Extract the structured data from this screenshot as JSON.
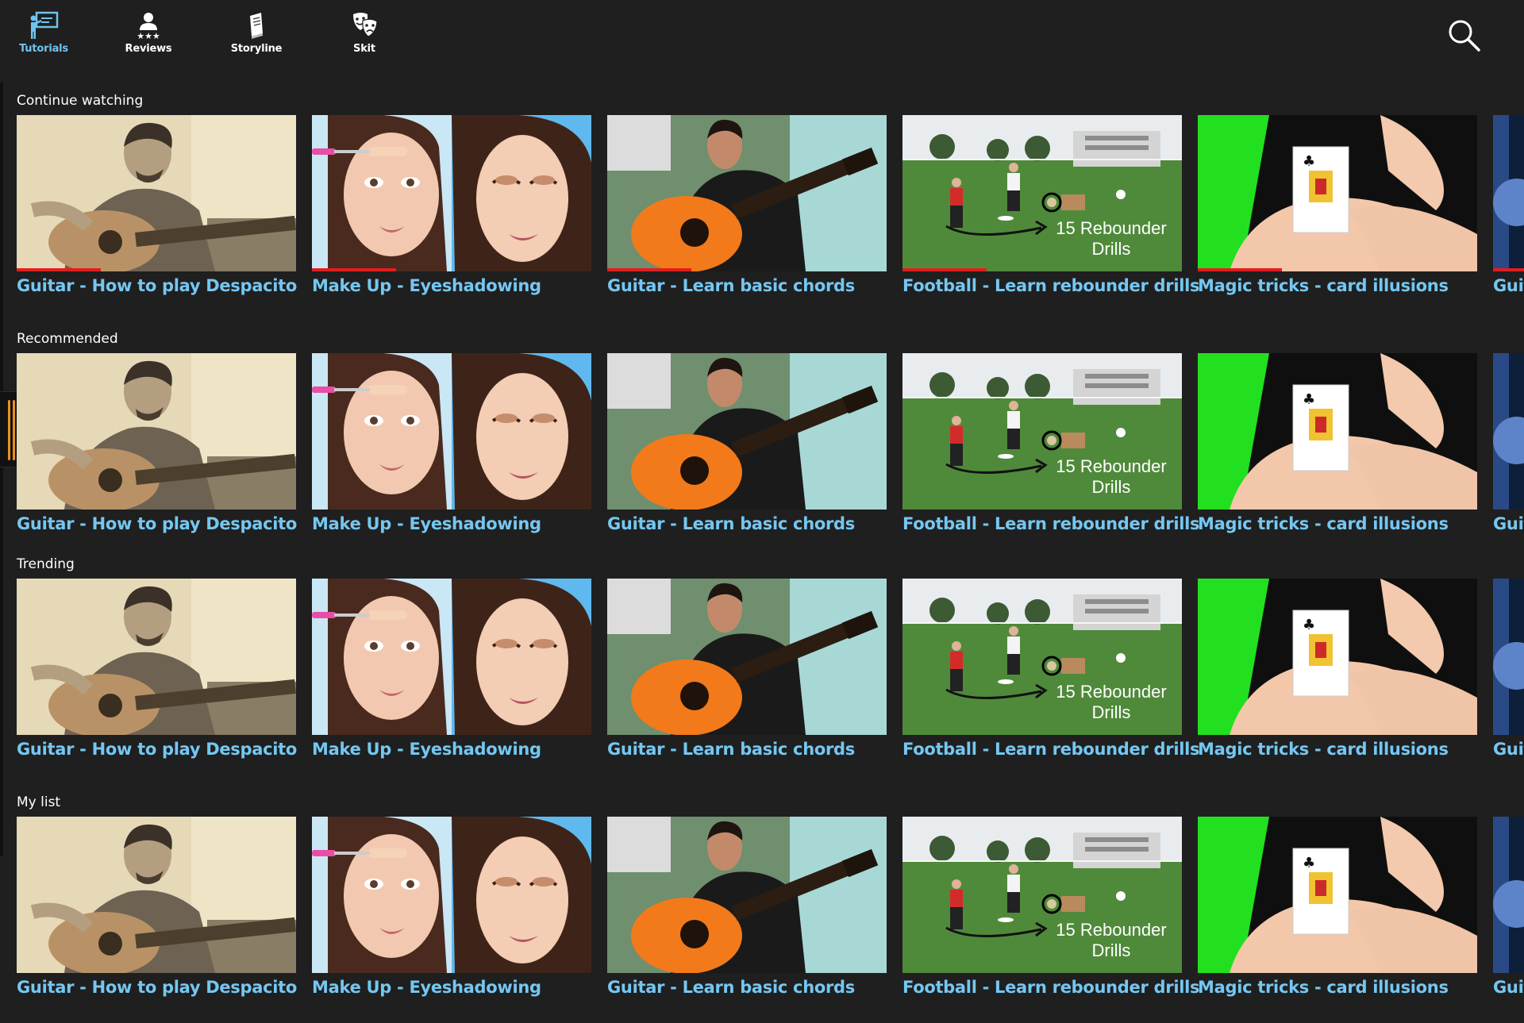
{
  "nav": {
    "items": [
      {
        "label": "Tutorials",
        "icon": "tutorial-presenter-icon",
        "active": true
      },
      {
        "label": "Reviews",
        "icon": "user-stars-icon",
        "active": false
      },
      {
        "label": "Storyline",
        "icon": "book-icon",
        "active": false
      },
      {
        "label": "Skit",
        "icon": "theater-masks-icon",
        "active": false
      }
    ],
    "search_icon": "search-icon"
  },
  "colors": {
    "background": "#1f1f1f",
    "active_nav": "#6fc3f0",
    "card_title": "#74c7f2",
    "progress": "#e31d1d",
    "scroll_handle": "#e8921e"
  },
  "sections": [
    {
      "title": "Continue watching",
      "cards": [
        {
          "title": "Guitar - How to play Despacito",
          "thumb": "guitar-sepia",
          "progress": 0.3
        },
        {
          "title": "Make Up - Eyeshadowing",
          "thumb": "makeup",
          "progress": 0.3
        },
        {
          "title": "Guitar - Learn basic chords",
          "thumb": "guitar-orange",
          "progress": 0.3
        },
        {
          "title": "Football - Learn rebounder drills",
          "thumb": "football",
          "progress": 0.3
        },
        {
          "title": "Magic tricks - card illusions",
          "thumb": "magic",
          "progress": 0.3
        },
        {
          "title": "Guit",
          "thumb": "partial",
          "progress": 0.3
        }
      ]
    },
    {
      "title": "Recommended",
      "cards": [
        {
          "title": "Guitar - How to play Despacito",
          "thumb": "guitar-sepia"
        },
        {
          "title": "Make Up - Eyeshadowing",
          "thumb": "makeup"
        },
        {
          "title": "Guitar - Learn basic chords",
          "thumb": "guitar-orange"
        },
        {
          "title": "Football - Learn rebounder drills",
          "thumb": "football"
        },
        {
          "title": "Magic tricks - card illusions",
          "thumb": "magic"
        },
        {
          "title": "Guit",
          "thumb": "partial"
        }
      ]
    },
    {
      "title": "Trending",
      "cards": [
        {
          "title": "Guitar - How to play Despacito",
          "thumb": "guitar-sepia"
        },
        {
          "title": "Make Up - Eyeshadowing",
          "thumb": "makeup"
        },
        {
          "title": "Guitar - Learn basic chords",
          "thumb": "guitar-orange"
        },
        {
          "title": "Football - Learn rebounder drills",
          "thumb": "football"
        },
        {
          "title": "Magic tricks - card illusions",
          "thumb": "magic"
        },
        {
          "title": "Guit",
          "thumb": "partial"
        }
      ]
    },
    {
      "title": "My list",
      "cards": [
        {
          "title": "Guitar - How to play Despacito",
          "thumb": "guitar-sepia"
        },
        {
          "title": "Make Up - Eyeshadowing",
          "thumb": "makeup"
        },
        {
          "title": "Guitar - Learn basic chords",
          "thumb": "guitar-orange"
        },
        {
          "title": "Football - Learn rebounder drills",
          "thumb": "football"
        },
        {
          "title": "Magic tricks - card illusions",
          "thumb": "magic"
        },
        {
          "title": "Guit",
          "thumb": "partial"
        }
      ]
    }
  ],
  "thumb_text": {
    "football": [
      "15 Rebounder",
      "Drills"
    ]
  }
}
